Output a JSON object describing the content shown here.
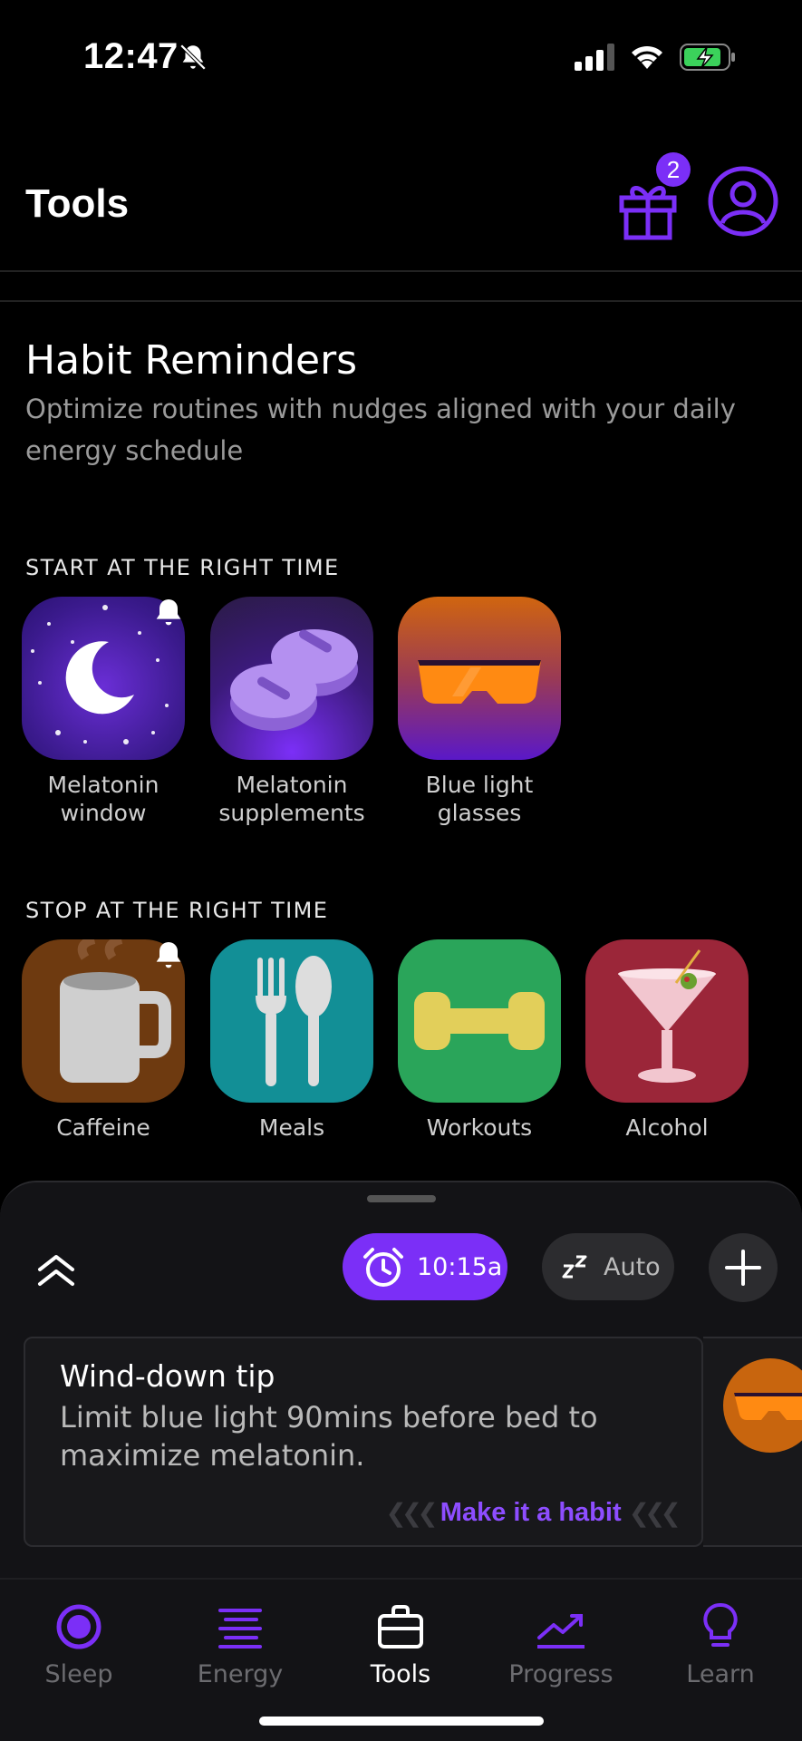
{
  "status_bar": {
    "time": "12:47"
  },
  "header": {
    "title": "Tools",
    "gift_badge_count": "2"
  },
  "section": {
    "title": "Habit Reminders",
    "description": "Optimize routines with nudges aligned with your daily energy schedule"
  },
  "start_group": {
    "heading": "START AT THE RIGHT TIME",
    "items": [
      {
        "label": "Melatonin window",
        "icon": "moon-icon",
        "has_reminder": true
      },
      {
        "label": "Melatonin supplements",
        "icon": "pills-icon",
        "has_reminder": false
      },
      {
        "label": "Blue light glasses",
        "icon": "glasses-icon",
        "has_reminder": false
      }
    ]
  },
  "stop_group": {
    "heading": "STOP AT THE RIGHT TIME",
    "items": [
      {
        "label": "Caffeine",
        "icon": "mug-icon",
        "has_reminder": true
      },
      {
        "label": "Meals",
        "icon": "fork-spoon-icon",
        "has_reminder": false
      },
      {
        "label": "Workouts",
        "icon": "dumbbell-icon",
        "has_reminder": false
      },
      {
        "label": "Alcohol",
        "icon": "martini-icon",
        "has_reminder": false
      }
    ]
  },
  "sheet": {
    "alarm_time": "10:15a",
    "sleep_mode": "Auto",
    "tip": {
      "title": "Wind-down tip",
      "body": "Limit blue light 90mins before bed to maximize melatonin.",
      "cta": "Make it a habit"
    }
  },
  "tabs": [
    {
      "label": "Sleep",
      "icon": "sleep-target-icon",
      "active": false
    },
    {
      "label": "Energy",
      "icon": "energy-lines-icon",
      "active": false
    },
    {
      "label": "Tools",
      "icon": "briefcase-icon",
      "active": true
    },
    {
      "label": "Progress",
      "icon": "trend-icon",
      "active": false
    },
    {
      "label": "Learn",
      "icon": "lightbulb-icon",
      "active": false
    }
  ],
  "colors": {
    "accent": "#7b2ff7",
    "cta": "#8d4dff",
    "background": "#000000",
    "sheet": "#131316"
  }
}
